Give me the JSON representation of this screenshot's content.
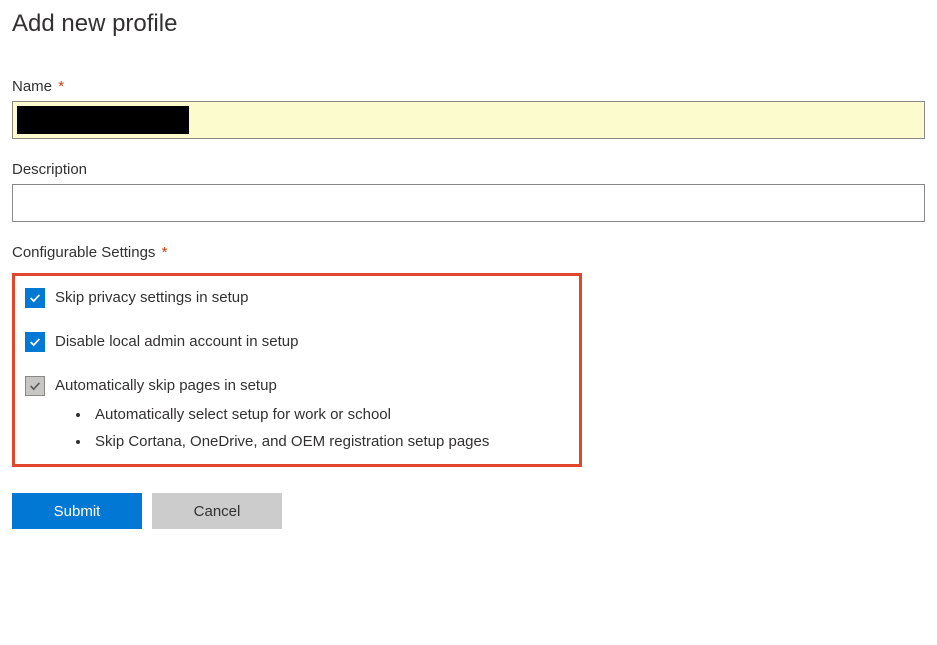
{
  "page": {
    "title": "Add new profile"
  },
  "fields": {
    "name": {
      "label": "Name",
      "required_marker": "*",
      "value": ""
    },
    "description": {
      "label": "Description",
      "value": ""
    }
  },
  "settings": {
    "label": "Configurable Settings",
    "required_marker": "*",
    "options": [
      {
        "label": "Skip privacy settings in setup",
        "checked": true,
        "disabled": false
      },
      {
        "label": "Disable local admin account in setup",
        "checked": true,
        "disabled": false
      },
      {
        "label": "Automatically skip pages in setup",
        "checked": true,
        "disabled": true,
        "sub_items": [
          "Automatically select setup for work or school",
          "Skip Cortana, OneDrive, and OEM registration setup pages"
        ]
      }
    ]
  },
  "buttons": {
    "submit": "Submit",
    "cancel": "Cancel"
  },
  "colors": {
    "primary": "#0078d4",
    "highlight_border": "#e2472e",
    "input_highlight": "#fbfbce"
  }
}
